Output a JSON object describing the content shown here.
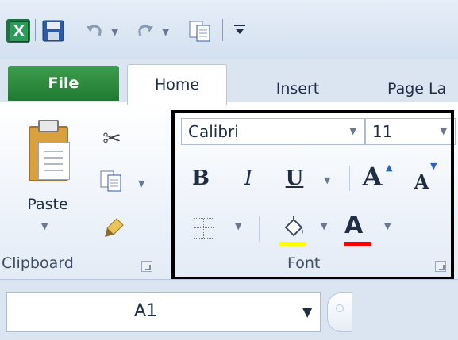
{
  "app": "Microsoft Excel",
  "quick_access": {
    "items": [
      "excel-logo",
      "save-icon",
      "undo-icon",
      "redo-icon",
      "copy-icon",
      "customize-icon"
    ]
  },
  "tabs": [
    {
      "label": "File"
    },
    {
      "label": "Home",
      "active": true
    },
    {
      "label": "Insert"
    },
    {
      "label": "Page La"
    }
  ],
  "clipboard": {
    "paste_label": "Paste",
    "group_label": "Clipboard"
  },
  "font": {
    "font_name": "Calibri",
    "font_size": "11",
    "bold_label": "B",
    "italic_label": "I",
    "underline_label": "U",
    "grow_label": "A",
    "shrink_label": "A",
    "font_color_label": "A",
    "group_label": "Font"
  },
  "formula_bar": {
    "name_box": "A1"
  },
  "colors": {
    "file_tab": "#2e8b3f",
    "fill_color": "#ffff00",
    "font_color": "#ff0000",
    "highlight_border": "#000000"
  }
}
